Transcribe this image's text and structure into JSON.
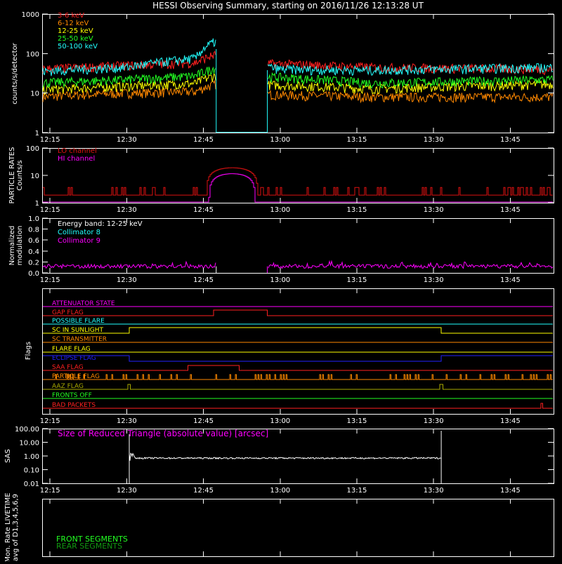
{
  "title": "HESSI Observing Summary, starting on 2016/11/26 12:13:28 UT",
  "colors": {
    "3-6": "#ff2020",
    "6-12": "#ff8800",
    "12-25": "#ffff00",
    "25-50": "#22ff22",
    "50-100": "#22ffff",
    "magenta": "#ff00ff",
    "white": "#ffffff"
  },
  "time_ticks": [
    "12:15",
    "12:30",
    "12:45",
    "13:00",
    "13:15",
    "13:30",
    "13:45"
  ],
  "chart_data": [
    {
      "id": "counts",
      "type": "line",
      "ylabel": "counts/s/detector",
      "yscale": "log",
      "ylim": [
        1,
        1000
      ],
      "ytick_labels": [
        "1",
        "10",
        "100",
        "1000"
      ],
      "x_unit": "minutes",
      "xlim": [
        "12:13:28",
        "13:53:28"
      ],
      "gap": [
        "12:47:30",
        "12:57:30"
      ],
      "series": [
        {
          "name": "3-6 keV",
          "color_key": "3-6",
          "levels": [
            [
              12.2,
              40
            ],
            [
              12.5,
              50
            ],
            [
              12.75,
              60
            ],
            [
              13.0,
              55
            ],
            [
              13.3,
              45
            ],
            [
              13.9,
              40
            ]
          ]
        },
        {
          "name": "6-12 keV",
          "color_key": "6-12",
          "levels": [
            [
              12.2,
              8
            ],
            [
              12.5,
              10
            ],
            [
              12.75,
              11
            ],
            [
              13.0,
              9
            ],
            [
              13.3,
              8
            ],
            [
              13.9,
              8
            ]
          ]
        },
        {
          "name": "12-25 keV",
          "color_key": "12-25",
          "levels": [
            [
              12.2,
              12
            ],
            [
              12.5,
              15
            ],
            [
              12.75,
              18
            ],
            [
              13.0,
              16
            ],
            [
              13.3,
              13
            ],
            [
              13.9,
              17
            ]
          ]
        },
        {
          "name": "25-50 keV",
          "color_key": "25-50",
          "levels": [
            [
              12.2,
              18
            ],
            [
              12.5,
              22
            ],
            [
              12.75,
              28
            ],
            [
              13.0,
              25
            ],
            [
              13.3,
              18
            ],
            [
              13.9,
              22
            ]
          ]
        },
        {
          "name": "50-100 keV",
          "color_key": "50-100",
          "levels": [
            [
              12.2,
              35
            ],
            [
              12.5,
              45
            ],
            [
              12.75,
              80
            ],
            [
              13.0,
              40
            ],
            [
              13.3,
              38
            ],
            [
              13.9,
              45
            ]
          ]
        }
      ]
    },
    {
      "id": "particle",
      "type": "line",
      "ylabel": "PARTICLE RATES",
      "ylabel2": "Counts/s",
      "yscale": "log",
      "ylim": [
        1,
        100
      ],
      "ytick_labels": [
        "1",
        "10",
        "100"
      ],
      "series": [
        {
          "name": "LO channel",
          "color_key": "3-6"
        },
        {
          "name": "HI channel",
          "color_key": "magenta"
        }
      ]
    },
    {
      "id": "modulation",
      "type": "line",
      "ylabel": "Normalized",
      "ylabel2": "modulation",
      "ylim": [
        0,
        1.0
      ],
      "ytick_labels": [
        "0.0",
        "0.2",
        "0.4",
        "0.6",
        "0.8",
        "1.0"
      ],
      "energy_label": "Energy band: 12-25 keV",
      "series": [
        {
          "name": "Collimator 8",
          "color_key": "50-100",
          "level": 0.12
        },
        {
          "name": "Collimator 9",
          "color_key": "magenta",
          "level": 0.12
        }
      ]
    },
    {
      "id": "flags",
      "type": "line",
      "ylabel": "Flags",
      "series": [
        {
          "name": "ATTENUATOR STATE",
          "color": "#ff00ff"
        },
        {
          "name": "GAP FLAG",
          "color": "#ff2020"
        },
        {
          "name": "POSSIBLE FLARE",
          "color": "#22ffff"
        },
        {
          "name": "SC IN SUNLIGHT",
          "color": "#ffff00"
        },
        {
          "name": "SC TRANSMITTER",
          "color": "#ff8800"
        },
        {
          "name": "FLARE FLAG",
          "color": "#ffff00"
        },
        {
          "name": "ECLIPSE FLAG",
          "color": "#2222ff"
        },
        {
          "name": "SAA FLAG",
          "color": "#ff2020"
        },
        {
          "name": "PARTICLE FLAG",
          "color": "#ff8800"
        },
        {
          "name": "AAZ FLAG",
          "color": "#aaaa00"
        },
        {
          "name": "FRONTS OFF",
          "color": "#22ff22"
        },
        {
          "name": "BAD PACKETS",
          "color": "#ff2020"
        }
      ]
    },
    {
      "id": "sas",
      "type": "line",
      "ylabel": "SAS",
      "yscale": "log",
      "ylim": [
        0.01,
        100
      ],
      "ytick_labels": [
        "0.01",
        "0.10",
        "1.00",
        "10.00",
        "100.00"
      ],
      "annotation": "Size of Reduced Triangle (absolute value) [arcsec]",
      "series": [
        {
          "name": "",
          "color_key": "white",
          "level": 0.7,
          "start": "12:30:30",
          "end": "13:31:30"
        }
      ]
    },
    {
      "id": "livetime",
      "type": "line",
      "ylabel": "Mon. Rate LIVETIME",
      "ylabel2": "avg of D1,3,4,5,6,9",
      "series": [
        {
          "name": "FRONT SEGMENTS",
          "color": "#22ff22"
        },
        {
          "name": "REAR SEGMENTS",
          "color": "#119911"
        }
      ]
    }
  ]
}
